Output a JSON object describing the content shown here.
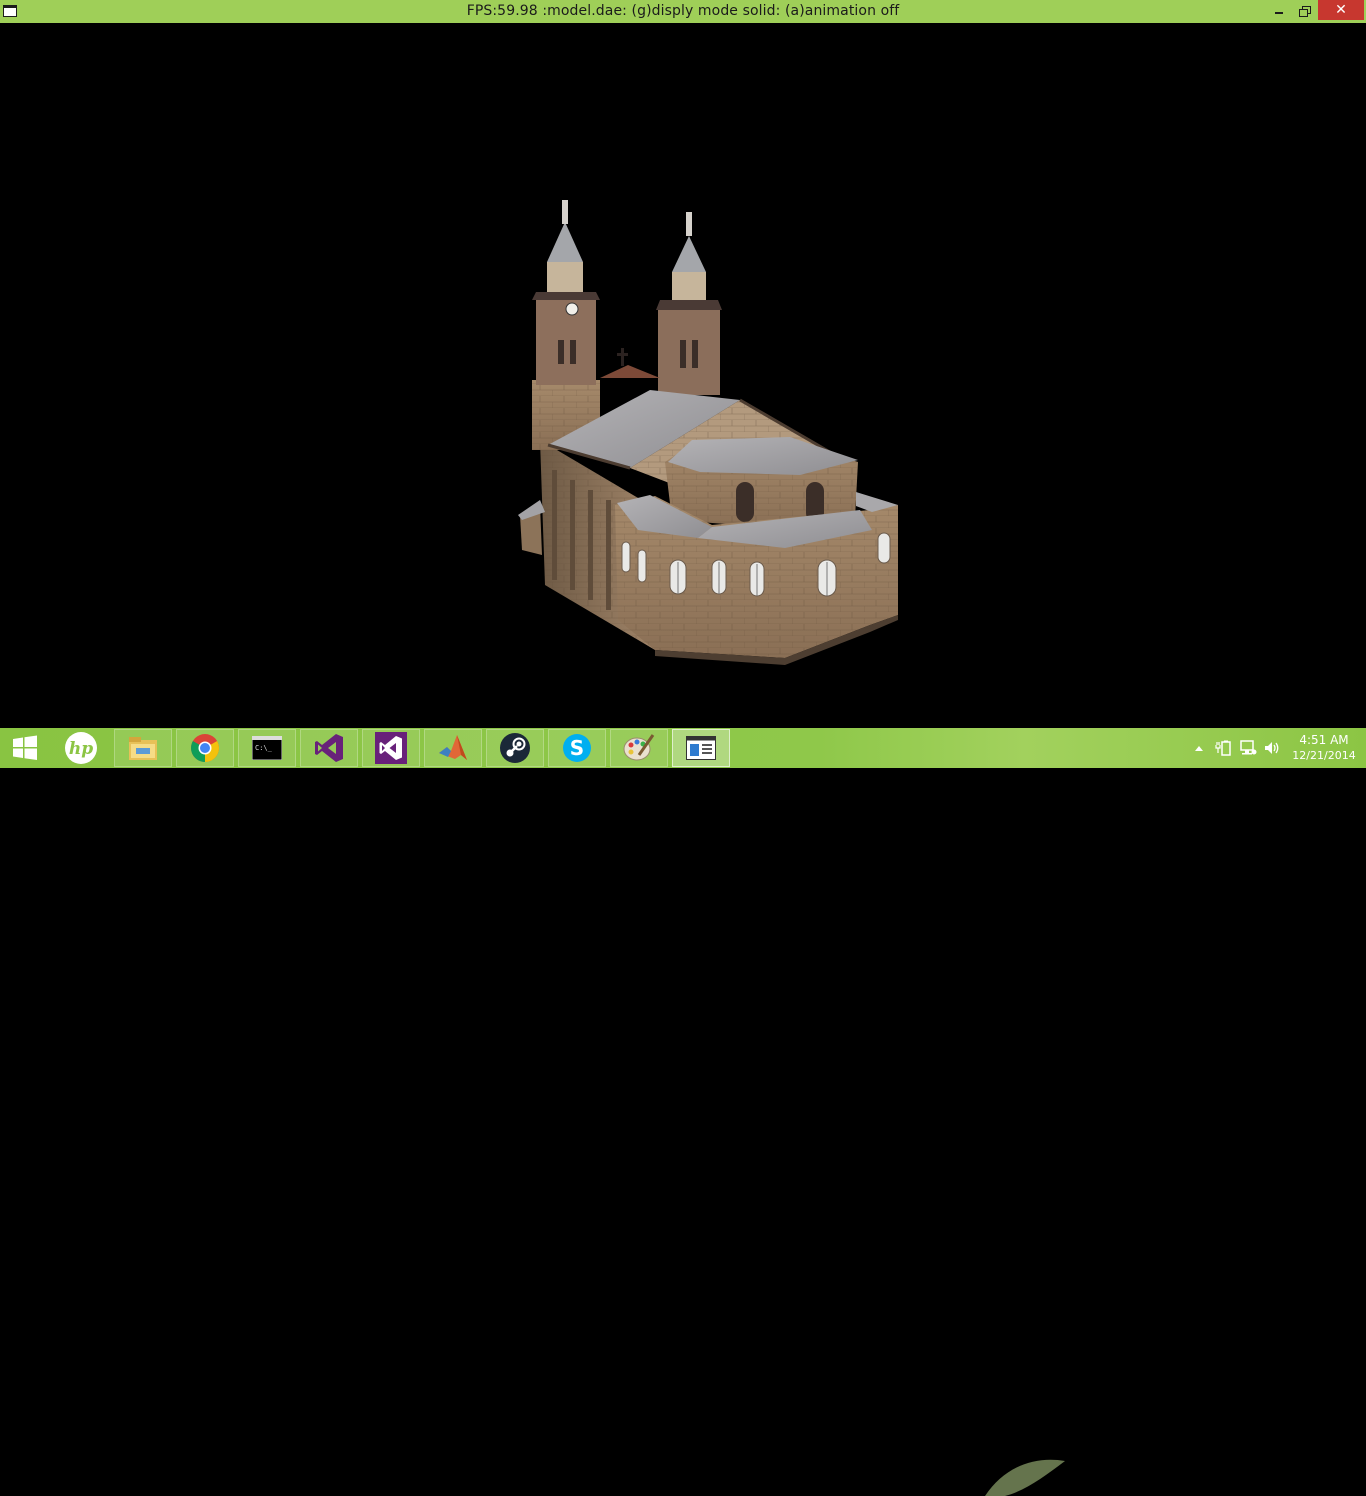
{
  "window": {
    "title": "FPS:59.98 :model.dae: (g)disply mode solid: (a)animation off",
    "icon": "app-window-icon",
    "controls": [
      "minimize",
      "restore",
      "close"
    ]
  },
  "viewport": {
    "background": "#000000",
    "content": "3d-church-model"
  },
  "taskbar": {
    "apps": [
      {
        "name": "start",
        "icon": "windows-logo-icon"
      },
      {
        "name": "hp",
        "icon": "hp-logo-icon"
      },
      {
        "name": "file-explorer",
        "icon": "folder-icon"
      },
      {
        "name": "chrome",
        "icon": "chrome-icon"
      },
      {
        "name": "command-prompt",
        "icon": "cmd-icon",
        "glyph": "C:\\_"
      },
      {
        "name": "visual-studio",
        "icon": "visual-studio-icon"
      },
      {
        "name": "visual-studio-2",
        "icon": "visual-studio-icon"
      },
      {
        "name": "matlab",
        "icon": "matlab-icon"
      },
      {
        "name": "steam",
        "icon": "steam-icon"
      },
      {
        "name": "skype",
        "icon": "skype-icon"
      },
      {
        "name": "paint",
        "icon": "paint-icon"
      },
      {
        "name": "model-viewer",
        "icon": "app-window-icon"
      }
    ],
    "tray": {
      "icons": [
        "chevron-up-icon",
        "power-icon",
        "network-icon",
        "volume-icon"
      ],
      "time": "4:51 AM",
      "date": "12/21/2014"
    },
    "colors": {
      "bar": "#8cc544",
      "title_bar": "#9fcf58",
      "close": "#c7372f"
    }
  }
}
